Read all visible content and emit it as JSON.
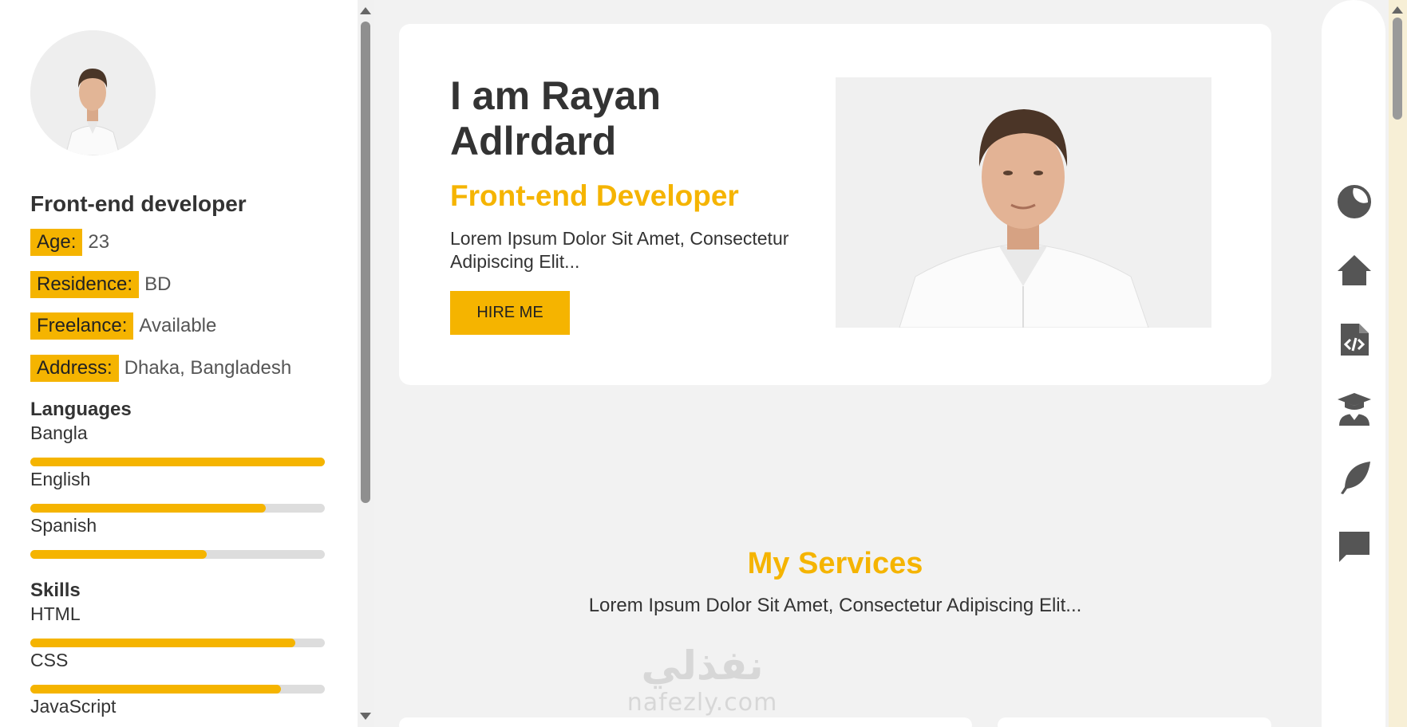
{
  "sidebar": {
    "role": "Front-end developer",
    "info": [
      {
        "label": "Age:",
        "value": "23"
      },
      {
        "label": "Residence:",
        "value": "BD"
      },
      {
        "label": "Freelance:",
        "value": "Available"
      },
      {
        "label": "Address:",
        "value": "Dhaka, Bangladesh"
      }
    ],
    "languages_title": "Languages",
    "languages": [
      {
        "name": "Bangla",
        "level": 1.0
      },
      {
        "name": "English",
        "level": 0.8
      },
      {
        "name": "Spanish",
        "level": 0.6
      }
    ],
    "skills_title": "Skills",
    "skills": [
      {
        "name": "HTML",
        "level": 0.9
      },
      {
        "name": "CSS",
        "level": 0.85
      },
      {
        "name": "JavaScript"
      }
    ]
  },
  "hero": {
    "title": "I am Rayan Adlrdard",
    "subtitle": "Front-end Developer",
    "text": "Lorem Ipsum Dolor Sit Amet, Consectetur Adipiscing Elit...",
    "button_label": "HIRE ME"
  },
  "services": {
    "title": "My Services",
    "text": "Lorem Ipsum Dolor Sit Amet, Consectetur Adipiscing Elit..."
  },
  "nav": [
    "theme-toggle-icon",
    "home-icon",
    "code-file-icon",
    "graduate-icon",
    "feather-icon",
    "chat-icon"
  ],
  "watermark": {
    "arabic": "نفذلي",
    "latin": "nafezly.com"
  },
  "colors": {
    "accent": "#f5b400",
    "text": "#333333",
    "background": "#f2f2f2",
    "icon": "#555555"
  }
}
